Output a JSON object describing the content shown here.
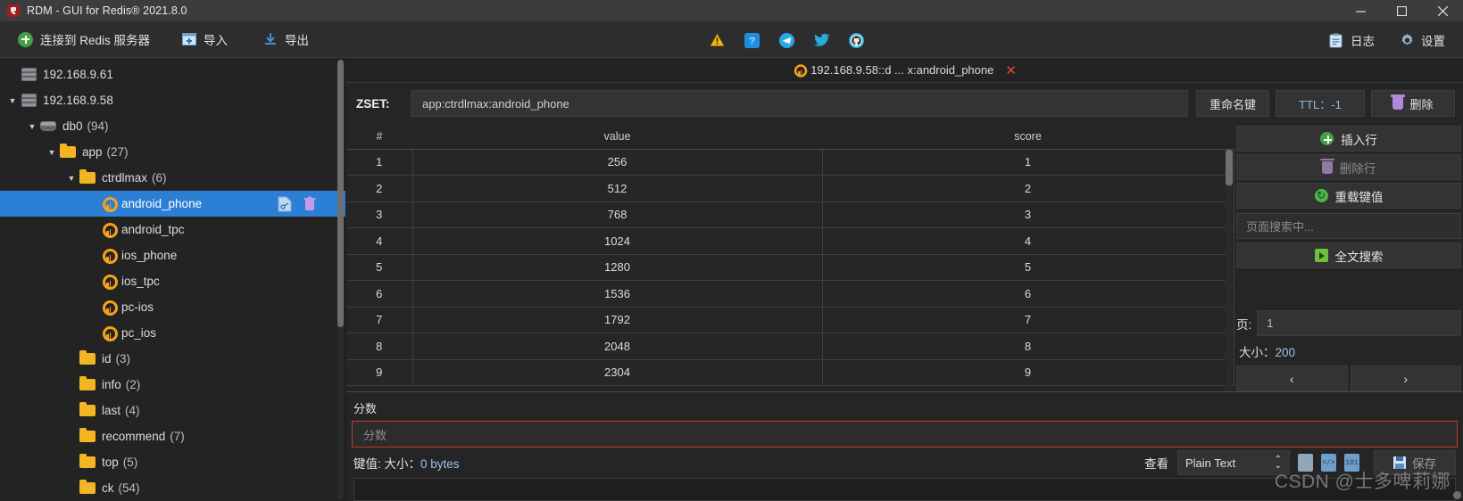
{
  "window": {
    "title": "RDM - GUI for Redis® 2021.8.0",
    "logo_icon": "rdm-logo-icon",
    "controls": {
      "minimize": "minimize-icon",
      "maximize": "maximize-icon",
      "close": "close-icon"
    }
  },
  "toolbar": {
    "left": [
      {
        "label": "连接到 Redis 服务器",
        "icon": "plus-circle-icon",
        "name": "connect-to-redis-server-button"
      },
      {
        "label": "导入",
        "icon": "import-icon",
        "name": "import-button"
      },
      {
        "label": "导出",
        "icon": "export-icon",
        "name": "export-button"
      }
    ],
    "middle_icons": [
      {
        "name": "warning-icon",
        "glyph": "⚠"
      },
      {
        "name": "help-icon",
        "glyph": "?"
      },
      {
        "name": "telegram-icon",
        "glyph": "✈"
      },
      {
        "name": "twitter-icon",
        "glyph": "🐦"
      },
      {
        "name": "github-icon",
        "glyph": ""
      }
    ],
    "right": [
      {
        "label": "日志",
        "icon": "log-icon",
        "name": "log-button"
      },
      {
        "label": "设置",
        "icon": "gear-icon",
        "name": "settings-button"
      }
    ]
  },
  "sidebar": {
    "nodes": [
      {
        "label": "192.168.9.61",
        "icon": "server-icon",
        "indent": 0,
        "arrow": "",
        "count": "",
        "selected": false
      },
      {
        "label": "192.168.9.58",
        "icon": "server-icon",
        "indent": 0,
        "arrow": "▼",
        "count": "",
        "selected": false
      },
      {
        "label": "db0",
        "icon": "database-icon",
        "indent": 1,
        "arrow": "▼",
        "count": "(94)",
        "selected": false
      },
      {
        "label": "app",
        "icon": "folder-icon",
        "indent": 2,
        "arrow": "▼",
        "count": "(27)",
        "selected": false
      },
      {
        "label": "ctrdlmax",
        "icon": "folder-icon",
        "indent": 3,
        "arrow": "▼",
        "count": "(6)",
        "selected": false
      },
      {
        "label": "android_phone",
        "icon": "key-icon",
        "indent": 4,
        "arrow": "",
        "count": "",
        "selected": true
      },
      {
        "label": "android_tpc",
        "icon": "key-icon",
        "indent": 4,
        "arrow": "",
        "count": "",
        "selected": false
      },
      {
        "label": "ios_phone",
        "icon": "key-icon",
        "indent": 4,
        "arrow": "",
        "count": "",
        "selected": false
      },
      {
        "label": "ios_tpc",
        "icon": "key-icon",
        "indent": 4,
        "arrow": "",
        "count": "",
        "selected": false
      },
      {
        "label": "pc-ios",
        "icon": "key-icon",
        "indent": 4,
        "arrow": "",
        "count": "",
        "selected": false
      },
      {
        "label": "pc_ios",
        "icon": "key-icon",
        "indent": 4,
        "arrow": "",
        "count": "",
        "selected": false
      },
      {
        "label": "id",
        "icon": "folder-icon",
        "indent": 3,
        "arrow": "",
        "count": "(3)",
        "selected": false
      },
      {
        "label": "info",
        "icon": "folder-icon",
        "indent": 3,
        "arrow": "",
        "count": "(2)",
        "selected": false
      },
      {
        "label": "last",
        "icon": "folder-icon",
        "indent": 3,
        "arrow": "",
        "count": "(4)",
        "selected": false
      },
      {
        "label": "recommend",
        "icon": "folder-icon",
        "indent": 3,
        "arrow": "",
        "count": "(7)",
        "selected": false
      },
      {
        "label": "top",
        "icon": "folder-icon",
        "indent": 3,
        "arrow": "",
        "count": "(5)",
        "selected": false
      },
      {
        "label": "ck",
        "icon": "folder-icon",
        "indent": 3,
        "arrow": "",
        "count": "(54)",
        "selected": false
      }
    ],
    "row_actions": {
      "edit": "edit-key-icon",
      "delete": "delete-key-icon"
    }
  },
  "tab": {
    "label": "192.168.9.58::d ... x:android_phone",
    "icon": "key-icon",
    "close": "✕"
  },
  "key_bar": {
    "type_label": "ZSET:",
    "key_name": "app:ctrdlmax:android_phone",
    "rename_label": "重命名键",
    "ttl_label": "TTL：-1",
    "delete_label": "删除"
  },
  "table": {
    "columns": [
      "#",
      "value",
      "score"
    ],
    "rows": [
      {
        "idx": "1",
        "value": "256",
        "score": "1"
      },
      {
        "idx": "2",
        "value": "512",
        "score": "2"
      },
      {
        "idx": "3",
        "value": "768",
        "score": "3"
      },
      {
        "idx": "4",
        "value": "1024",
        "score": "4"
      },
      {
        "idx": "5",
        "value": "1280",
        "score": "5"
      },
      {
        "idx": "6",
        "value": "1536",
        "score": "6"
      },
      {
        "idx": "7",
        "value": "1792",
        "score": "7"
      },
      {
        "idx": "8",
        "value": "2048",
        "score": "8"
      },
      {
        "idx": "9",
        "value": "2304",
        "score": "9"
      }
    ]
  },
  "side_actions": {
    "insert_row": "插入行",
    "delete_row": "删除行",
    "reload_value": "重载键值",
    "search_placeholder": "页面搜索中...",
    "full_text_search": "全文搜索",
    "page_label": "页:",
    "page_value": "1",
    "size_label": "大小：",
    "size_value": "200",
    "prev": "‹",
    "next": "›"
  },
  "editor": {
    "field_label": "分数",
    "field_placeholder": "分数",
    "value_meta_label": "键值: 大小：",
    "value_meta_value": "0 bytes",
    "view_label": "查看",
    "view_format": "Plain Text",
    "save_label": "保存",
    "icons": [
      "clipboard-icon",
      "code-doc-icon",
      "binary-doc-icon",
      "save-icon"
    ]
  },
  "watermark": "CSDN @士多啤莉娜",
  "colors": {
    "accent_blue": "#2b7fd4",
    "folder_yellow": "#f3b521",
    "key_orange": "#f7a31a",
    "error_red": "#c0392b",
    "link_blue": "#9cc2e8"
  }
}
